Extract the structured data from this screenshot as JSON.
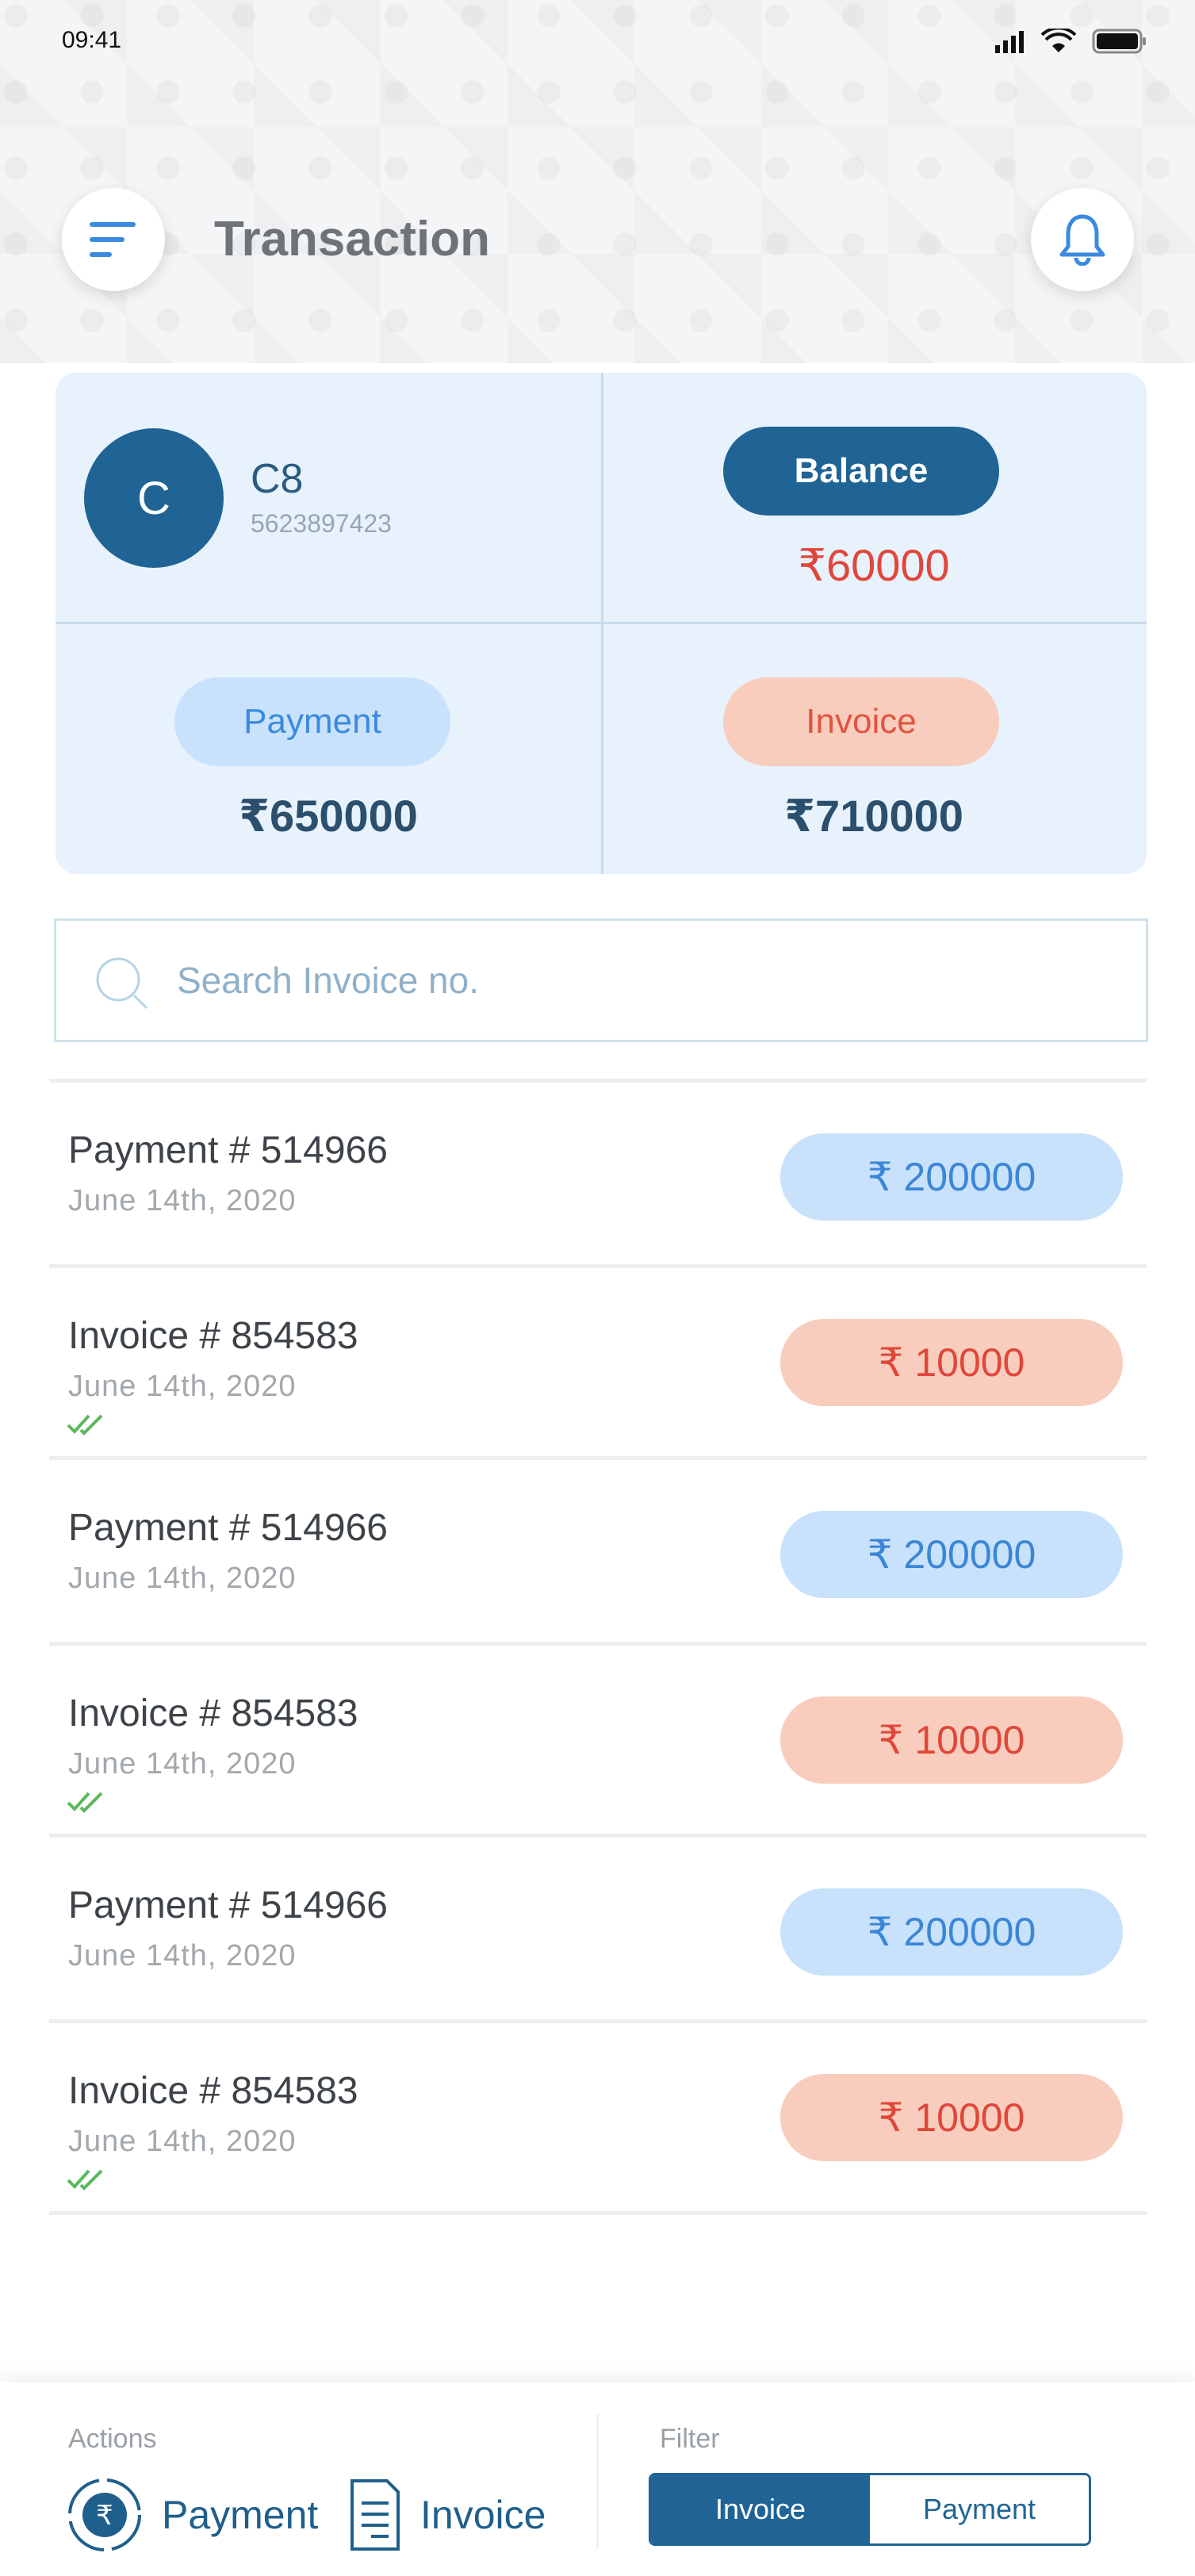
{
  "status_bar": {
    "time": "09:41"
  },
  "header": {
    "title": "Transaction"
  },
  "summary": {
    "customer": {
      "initial": "C",
      "name": "C8",
      "phone": "5623897423"
    },
    "balance": {
      "label": "Balance",
      "amount": "₹60000"
    },
    "payment": {
      "label": "Payment",
      "amount": "₹650000"
    },
    "invoice": {
      "label": "Invoice",
      "amount": "₹710000"
    }
  },
  "search": {
    "placeholder": "Search Invoice no."
  },
  "transactions": [
    {
      "type": "payment",
      "title": "Payment # 514966",
      "date": "June 14th, 2020",
      "amount": "₹ 200000"
    },
    {
      "type": "invoice",
      "title": "Invoice # 854583",
      "date": "June 14th, 2020",
      "amount": "₹ 10000"
    },
    {
      "type": "payment",
      "title": "Payment # 514966",
      "date": "June 14th, 2020",
      "amount": "₹ 200000"
    },
    {
      "type": "invoice",
      "title": "Invoice # 854583",
      "date": "June 14th, 2020",
      "amount": "₹ 10000"
    },
    {
      "type": "payment",
      "title": "Payment # 514966",
      "date": "June 14th, 2020",
      "amount": "₹ 200000"
    },
    {
      "type": "invoice",
      "title": "Invoice # 854583",
      "date": "June 14th, 2020",
      "amount": "₹ 10000"
    }
  ],
  "bottom": {
    "actions_label": "Actions",
    "filter_label": "Filter",
    "actions": {
      "payment": "Payment",
      "invoice": "Invoice"
    },
    "filter": {
      "invoice": "Invoice",
      "payment": "Payment",
      "selected": "Invoice"
    }
  },
  "colors": {
    "primary": "#1f6494",
    "payment_bg": "#c9e2fb",
    "payment_text": "#3b86d6",
    "invoice_bg": "#f8cdbd",
    "invoice_text": "#e0473b",
    "summary_bg": "#e7f2fd",
    "check": "#5cb85c"
  },
  "icons": {
    "menu": "hamburger-menu-icon",
    "bell": "bell-icon",
    "search": "search-icon",
    "check": "double-check-icon",
    "rupee": "rupee-cycle-icon",
    "invoice": "document-icon"
  }
}
